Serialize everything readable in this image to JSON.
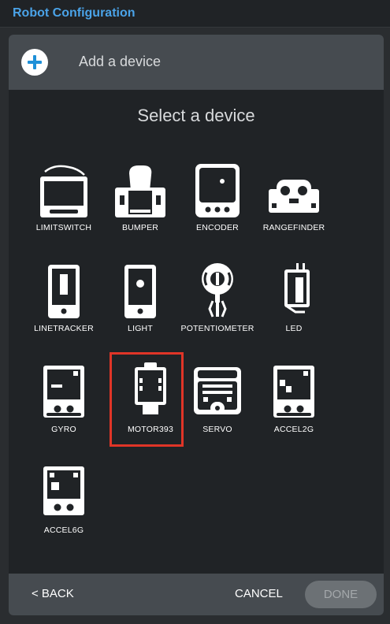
{
  "app": {
    "title": "Robot Configuration",
    "accent_color": "#4aa3e8"
  },
  "dialog": {
    "header_label": "Add a device",
    "header_icon": "plus-circle-icon",
    "select_title": "Select a device",
    "selection_color": "#e03527",
    "devices": [
      {
        "label": "LIMITSWITCH",
        "icon": "limitswitch-icon"
      },
      {
        "label": "BUMPER",
        "icon": "bumper-icon"
      },
      {
        "label": "ENCODER",
        "icon": "encoder-icon"
      },
      {
        "label": "RANGEFINDER",
        "icon": "rangefinder-icon"
      },
      {
        "label": "LINETRACKER",
        "icon": "linetracker-icon"
      },
      {
        "label": "LIGHT",
        "icon": "light-icon"
      },
      {
        "label": "POTENTIOMETER",
        "icon": "potentiometer-icon"
      },
      {
        "label": "LED",
        "icon": "led-icon"
      },
      {
        "label": "GYRO",
        "icon": "gyro-icon"
      },
      {
        "label": "MOTOR393",
        "icon": "motor393-icon",
        "selected": true
      },
      {
        "label": "SERVO",
        "icon": "servo-icon"
      },
      {
        "label": "ACCEL2G",
        "icon": "accel2g-icon"
      },
      {
        "label": "ACCEL6G",
        "icon": "accel6g-icon"
      }
    ],
    "footer": {
      "back_label": "< BACK",
      "cancel_label": "CANCEL",
      "done_label": "DONE"
    }
  }
}
